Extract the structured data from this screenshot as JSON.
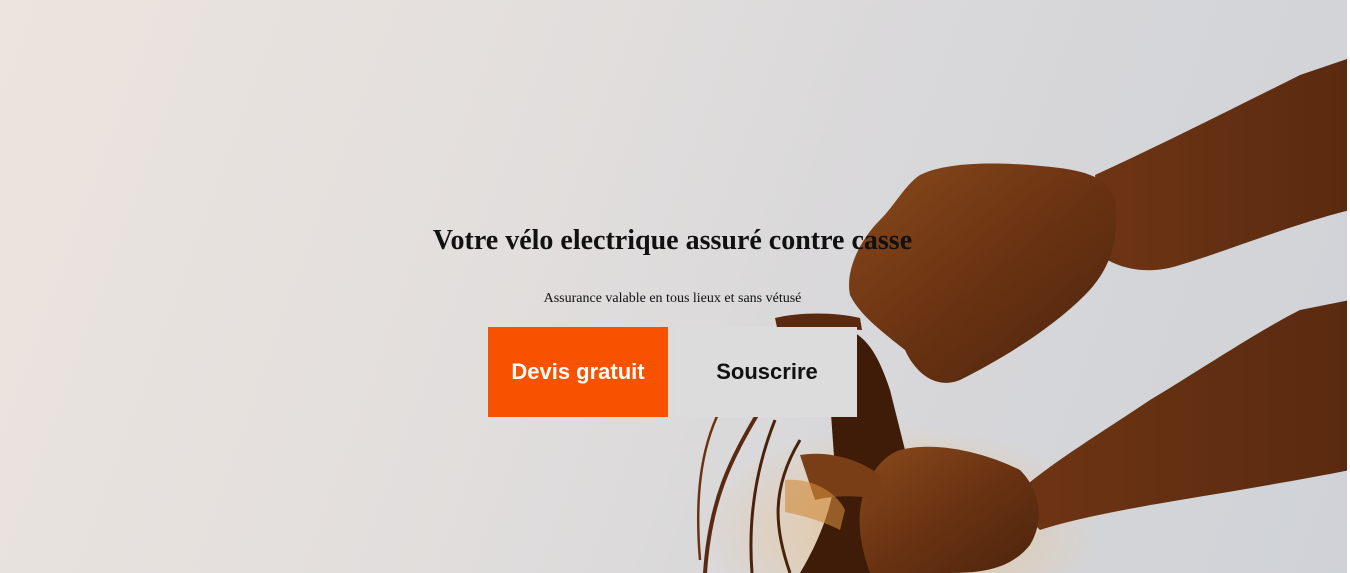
{
  "hero": {
    "title": "Votre vélo electrique assuré contre casse",
    "subtitle": "Assurance valable en tous lieux et sans vétusé",
    "image_icon": "cyclist-hands-on-handlebar-photo"
  },
  "buttons": {
    "quote_label": "Devis gratuit",
    "subscribe_label": "Souscrire"
  },
  "colors": {
    "primary": "#f85200",
    "secondary": "#dcdcdc"
  }
}
